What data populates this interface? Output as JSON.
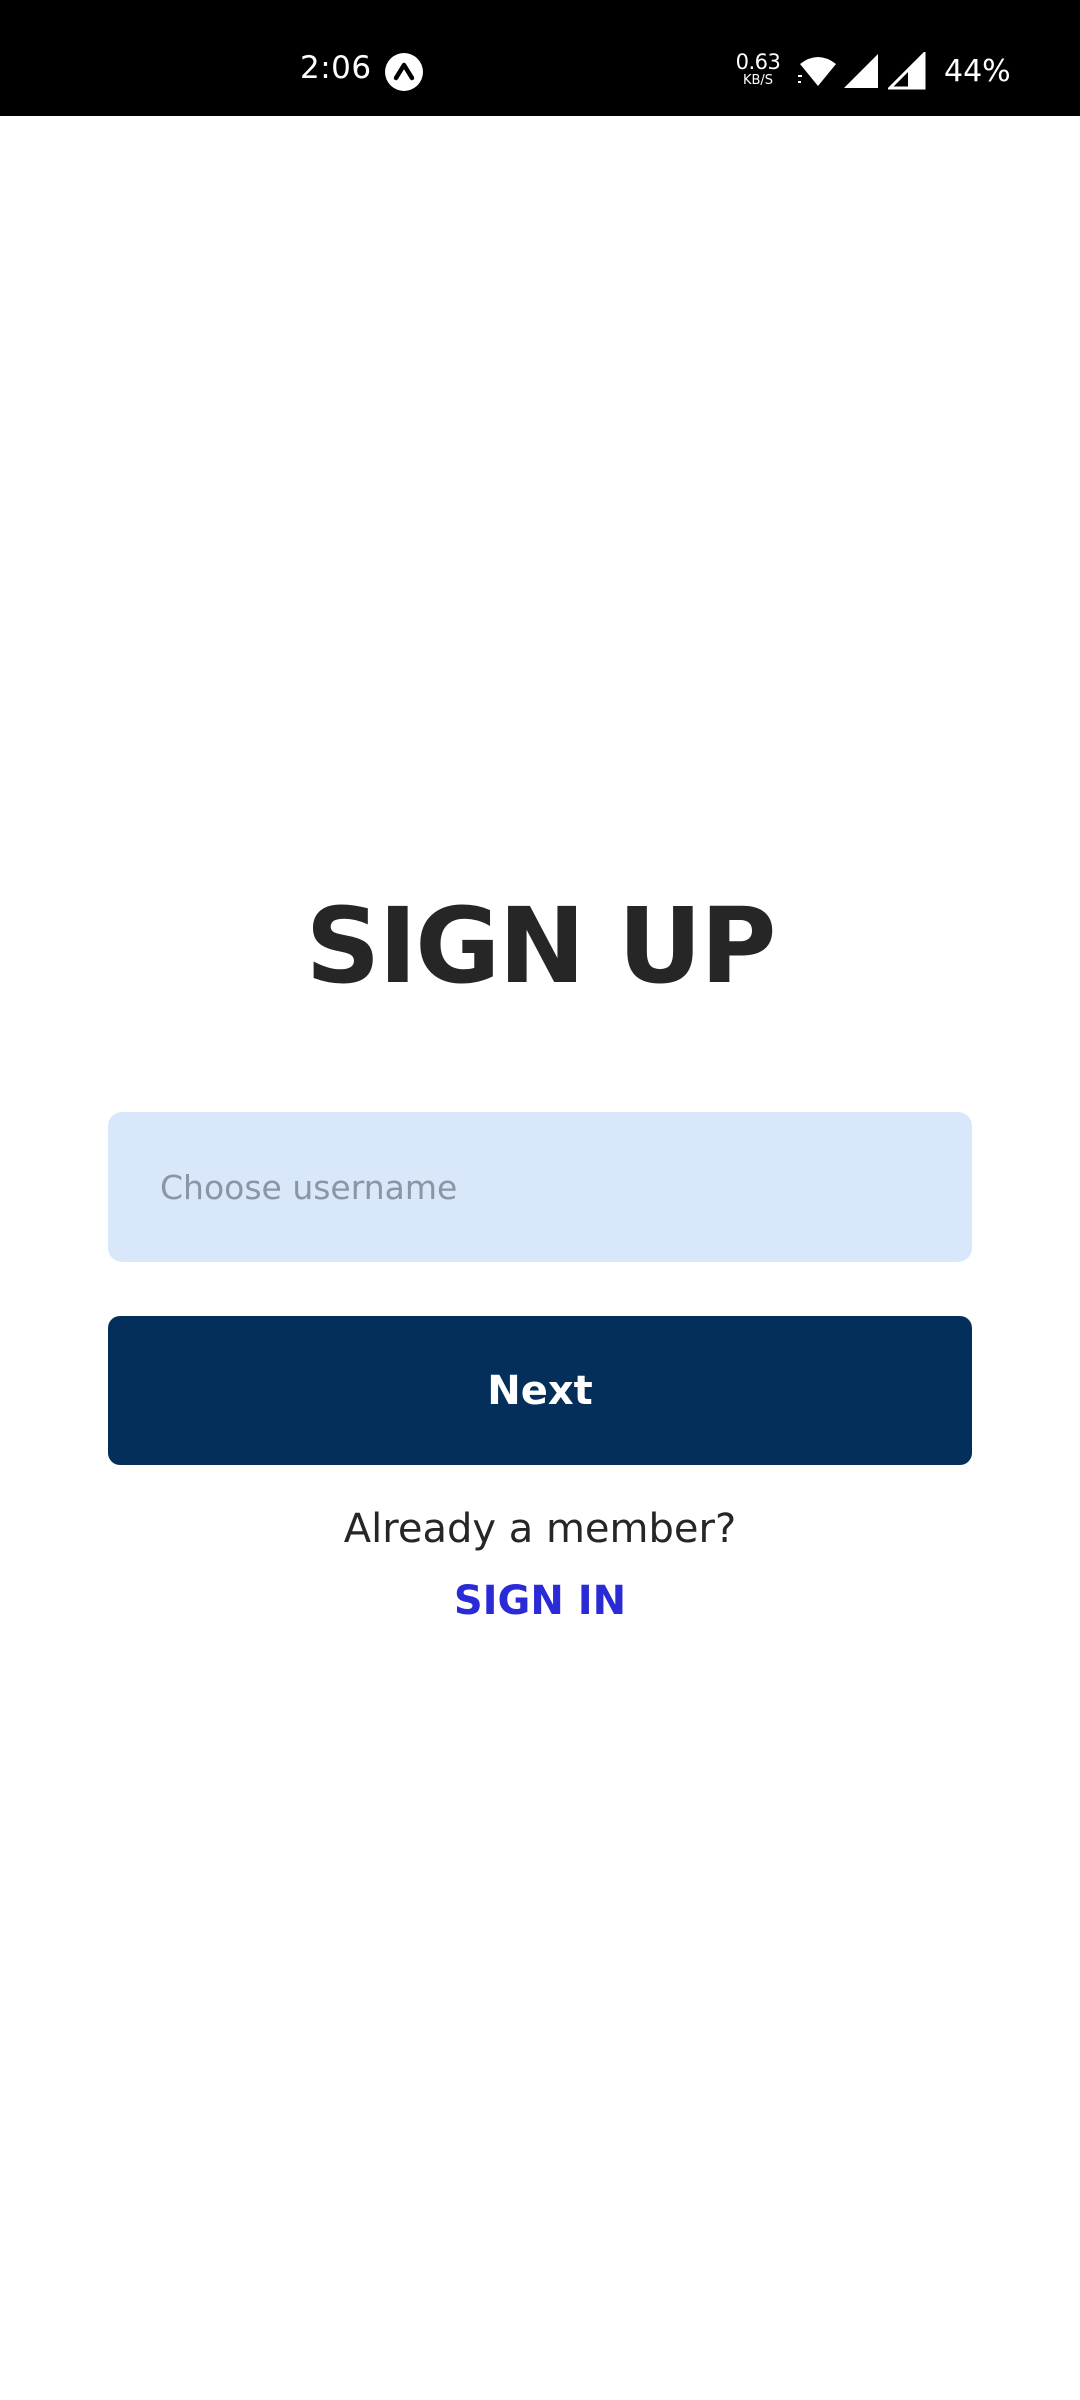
{
  "status_bar": {
    "time": "2:06",
    "app_icon": "caret-up-circle-icon",
    "net_speed_value": "0.63",
    "net_speed_unit": "KB/S",
    "wifi_icon": "wifi-icon",
    "signal_icons": [
      "signal-icon",
      "signal-icon"
    ],
    "battery": "44%"
  },
  "screen": {
    "title": "SIGN UP",
    "username_placeholder": "Choose username",
    "username_value": "",
    "next_label": "Next",
    "member_prompt": "Already a member?",
    "signin_label": "SIGN IN"
  },
  "colors": {
    "title_text": "#262626",
    "input_bg": "#d9e7fb",
    "placeholder": "#8b95a3",
    "primary_button": "#032f5a",
    "link": "#2a2bd6"
  }
}
